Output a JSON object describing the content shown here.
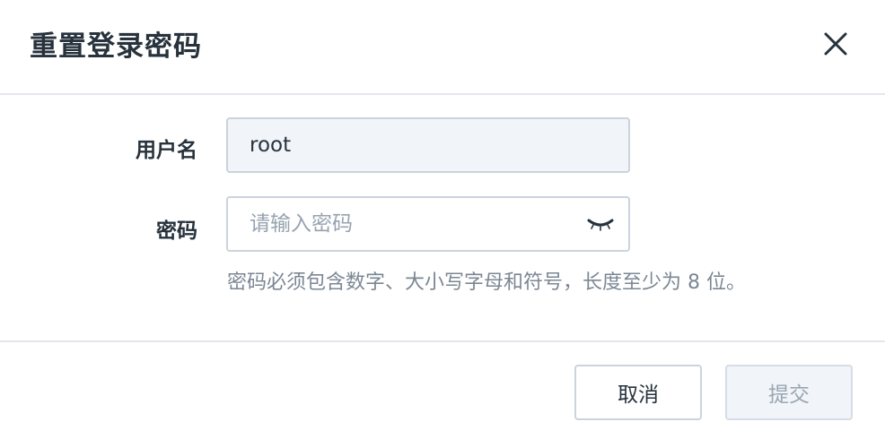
{
  "dialog": {
    "title": "重置登录密码",
    "close_icon": "close-icon"
  },
  "form": {
    "username": {
      "label": "用户名",
      "value": "root"
    },
    "password": {
      "label": "密码",
      "value": "",
      "placeholder": "请输入密码",
      "toggle_icon": "eye-closed-icon"
    },
    "hint": "密码必须包含数字、大小写字母和符号，长度至少为 8 位。"
  },
  "footer": {
    "cancel_label": "取消",
    "submit_label": "提交",
    "submit_disabled": true
  }
}
